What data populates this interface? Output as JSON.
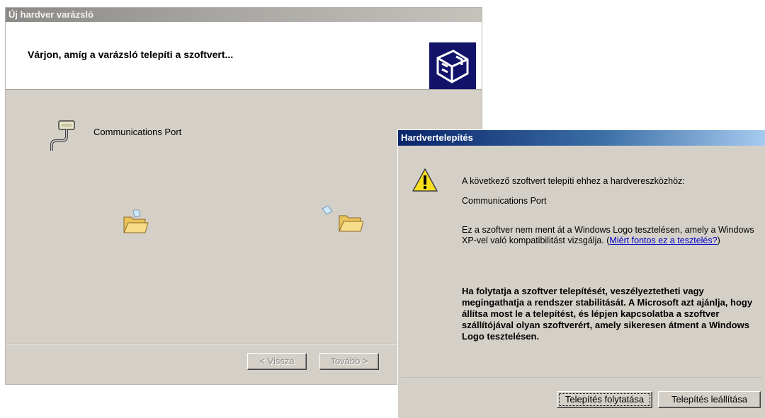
{
  "wizard": {
    "title": "Új hardver varázsló",
    "header_text": "Várjon, amíg a varázsló telepíti a szoftvert...",
    "device_name": "Communications Port",
    "buttons": {
      "back": "< Vissza",
      "next": "Tovább >"
    }
  },
  "dialog": {
    "title": "Hardvertelepítés",
    "message_intro": "A következő szoftvert telepíti ehhez a hardvereszközhöz:",
    "device_name": "Communications Port",
    "logo_text": "Ez a szoftver nem ment át a Windows Logo tesztelésen, amely a Windows XP-vel való kompatibilitást vizsgálja. (",
    "logo_link": "Miért fontos ez a tesztelés?",
    "logo_text_end": ")",
    "warning": "Ha folytatja a szoftver telepítését, veszélyeztetheti vagy megingathatja a rendszer stabilitását. A Microsoft azt ajánlja, hogy állítsa most le a telepítést, és lépjen kapcsolatba a szoftver szállítójával olyan szoftverért, amely sikeresen átment a Windows Logo tesztelésen.",
    "buttons": {
      "continue": "Telepítés folytatása",
      "stop": "Telepítés leállítása"
    }
  },
  "icons": {
    "header_icon": "hardware-wizard-icon",
    "device_icon": "serial-port-icon",
    "folder_source": "folder-icon",
    "folder_target": "folder-icon",
    "warning_icon": "warning-icon"
  },
  "colors": {
    "dialog_titlebar": "#0a246a",
    "window_face": "#d4d0c8",
    "link": "#0000cc"
  }
}
